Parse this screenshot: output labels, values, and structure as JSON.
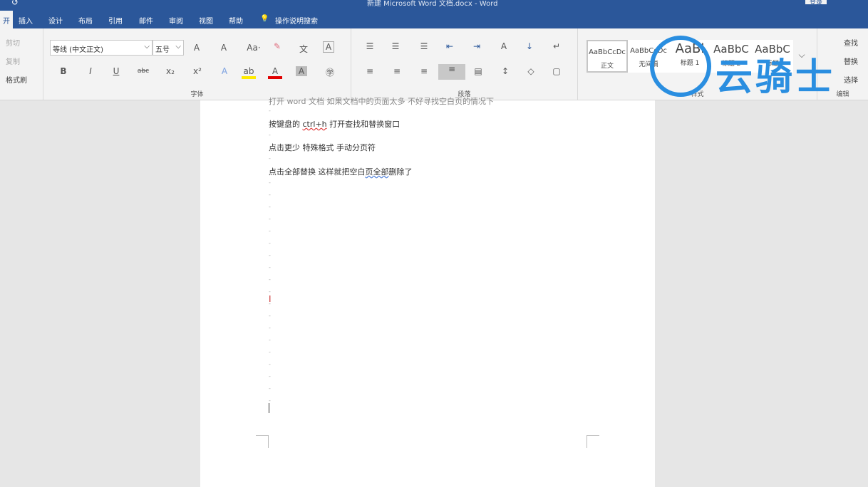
{
  "title_bar": {
    "title": "新建 Microsoft Word 文档.docx  -  Word",
    "login": "登录"
  },
  "tabs": [
    "插入",
    "设计",
    "布局",
    "引用",
    "邮件",
    "审阅",
    "视图",
    "帮助"
  ],
  "tell_me": "操作说明搜索",
  "clipboard": {
    "cut": "剪切",
    "copy": "复制",
    "format_painter": "格式刷"
  },
  "font": {
    "name": "等线 (中文正文)",
    "size": "五号",
    "label": "字体"
  },
  "paragraph": {
    "label": "段落"
  },
  "styles": {
    "label": "样式",
    "items": [
      {
        "preview": "AaBbCcDc",
        "name": "正文"
      },
      {
        "preview": "AaBbCcDc",
        "name": "无间隔"
      },
      {
        "preview": "AaBl",
        "name": "标题 1"
      },
      {
        "preview": "AaBbC",
        "name": "标题 2"
      },
      {
        "preview": "AaBbC",
        "name": "标题"
      }
    ]
  },
  "editing": {
    "find": "查找",
    "replace": "替换",
    "select": "选择",
    "label": "编辑"
  },
  "watermark": {
    "text": "云骑士"
  },
  "document": {
    "lines": [
      "打开 word 文档 如果文档中的页面太多 不好寻找空白页的情况下",
      "按键盘的 ",
      "ctrl+h",
      " 打开查找和替换窗口",
      "点击更少  特殊格式  手动分页符",
      "点击全部替换  这样就把空白",
      "页全部",
      "删除了"
    ]
  },
  "colors": {
    "accent": "#2b579a",
    "watermark": "#2a8ee0"
  }
}
